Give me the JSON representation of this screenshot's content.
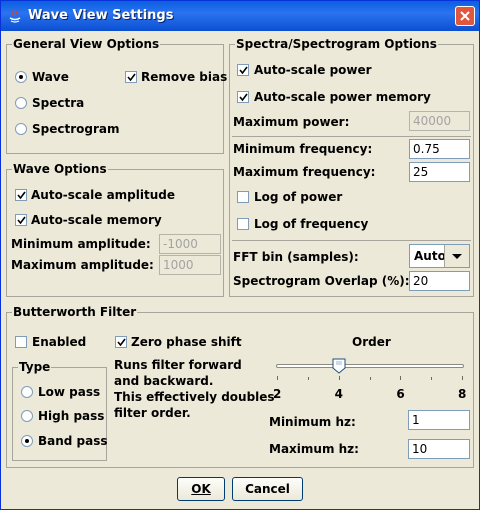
{
  "window": {
    "title": "Wave View Settings"
  },
  "general": {
    "title": "General View Options",
    "options": [
      "Wave",
      "Spectra",
      "Spectrogram"
    ],
    "selected": "Wave",
    "remove_bias_label": "Remove bias",
    "remove_bias_checked": true
  },
  "wave": {
    "title": "Wave Options",
    "autoscale_amplitude_label": "Auto-scale amplitude",
    "autoscale_amplitude_checked": true,
    "autoscale_memory_label": "Auto-scale memory",
    "autoscale_memory_checked": true,
    "min_amp_label": "Minimum amplitude:",
    "min_amp_value": "-1000",
    "max_amp_label": "Maximum amplitude:",
    "max_amp_value": "1000"
  },
  "spectra": {
    "title": "Spectra/Spectrogram Options",
    "autoscale_power_label": "Auto-scale power",
    "autoscale_power_checked": true,
    "autoscale_power_memory_label": "Auto-scale power memory",
    "autoscale_power_memory_checked": true,
    "max_power_label": "Maximum power:",
    "max_power_value": "40000",
    "min_freq_label": "Minimum frequency:",
    "min_freq_value": "0.75",
    "max_freq_label": "Maximum frequency:",
    "max_freq_value": "25",
    "log_power_label": "Log of power",
    "log_power_checked": false,
    "log_freq_label": "Log of frequency",
    "log_freq_checked": false,
    "fft_label": "FFT bin (samples):",
    "fft_value": "Auto",
    "overlap_label": "Spectrogram Overlap (%):",
    "overlap_value": "20"
  },
  "butterworth": {
    "title": "Butterworth Filter",
    "enabled_label": "Enabled",
    "enabled_checked": false,
    "zero_phase_label": "Zero phase shift",
    "zero_phase_checked": true,
    "zero_phase_desc": [
      "Runs filter forward",
      "and backward.",
      "This effectively doubles",
      "filter order."
    ],
    "type_title": "Type",
    "types": [
      "Low pass",
      "High pass",
      "Band pass"
    ],
    "type_selected": "Band pass",
    "order_label": "Order",
    "order_ticks": [
      "2",
      "4",
      "6",
      "8"
    ],
    "order_min": 2,
    "order_max": 8,
    "order_value": 4,
    "min_hz_label": "Minimum hz:",
    "min_hz_value": "1",
    "max_hz_label": "Maximum hz:",
    "max_hz_value": "10"
  },
  "buttons": {
    "ok": "OK",
    "cancel": "Cancel"
  }
}
